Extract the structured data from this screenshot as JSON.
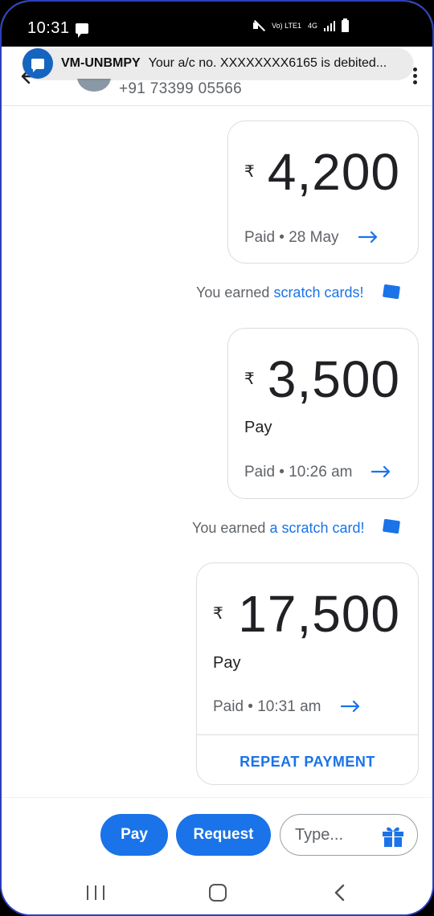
{
  "status_bar": {
    "time": "10:31",
    "network_lte": "Vo) LTE1",
    "network_4g": "4G"
  },
  "notification": {
    "sender": "VM-UNBMPY",
    "text": "Your a/c no. XXXXXXXX6165 is debited..."
  },
  "header": {
    "phone_number": "+91 73399 05566"
  },
  "messages": [
    {
      "currency": "₹",
      "amount": "4,200",
      "status": "Paid • 28 May"
    },
    {
      "earned_prefix": "You earned ",
      "earned_link": "scratch cards!"
    },
    {
      "currency": "₹",
      "amount": "3,500",
      "note": "Pay",
      "status": "Paid • 10:26 am"
    },
    {
      "earned_prefix": "You earned ",
      "earned_link": "a scratch card!"
    },
    {
      "currency": "₹",
      "amount": "17,500",
      "note": "Pay",
      "status": "Paid • 10:31 am",
      "action": "REPEAT PAYMENT"
    }
  ],
  "composer": {
    "pay_label": "Pay",
    "request_label": "Request",
    "placeholder": "Type..."
  },
  "colors": {
    "accent": "#1a73e8",
    "notification_icon": "#1565c0"
  },
  "icons": {
    "back": "arrow-back-icon",
    "more": "more-vert-icon",
    "arrow": "arrow-right-icon",
    "scratch_card": "scratch-card-icon",
    "gift": "gift-icon"
  }
}
